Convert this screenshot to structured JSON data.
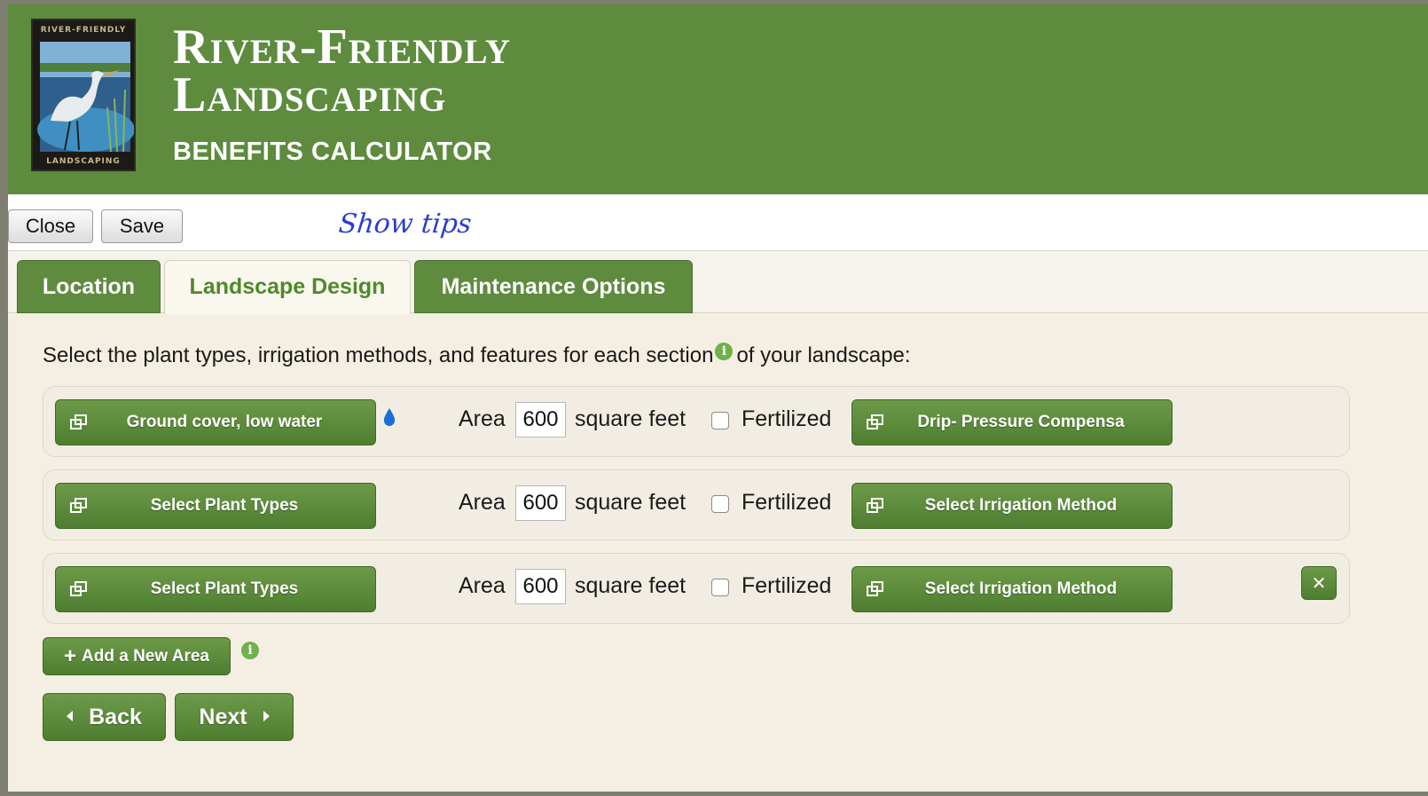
{
  "header": {
    "logo_top_text": "RIVER-FRIENDLY",
    "logo_bottom_text": "LANDSCAPING",
    "title_line1": "River-Friendly",
    "title_line2": "Landscaping",
    "subtitle": "BENEFITS CALCULATOR"
  },
  "toolbar": {
    "close_label": "Close",
    "save_label": "Save",
    "tips_label": "Show tips"
  },
  "tabs": [
    {
      "label": "Location",
      "active": false
    },
    {
      "label": "Landscape Design",
      "active": true
    },
    {
      "label": "Maintenance Options",
      "active": false
    }
  ],
  "instructions": {
    "before": "Select the plant types, irrigation methods, and features for each section",
    "after": "of your landscape:"
  },
  "areas": [
    {
      "plant": "Ground cover, low water",
      "area_label": "Area",
      "area_value": "600",
      "unit": "square feet",
      "fertilized_label": "Fertilized",
      "fertilized": false,
      "irrigation": "Drip- Pressure Compensa"
    },
    {
      "plant": "Select Plant Types",
      "area_label": "Area",
      "area_value": "600",
      "unit": "square feet",
      "fertilized_label": "Fertilized",
      "fertilized": false,
      "irrigation": "Select Irrigation Method"
    },
    {
      "plant": "Select Plant Types",
      "area_label": "Area",
      "area_value": "600",
      "unit": "square feet",
      "fertilized_label": "Fertilized",
      "fertilized": false,
      "irrigation": "Select Irrigation Method"
    }
  ],
  "actions": {
    "add_area_label": "Add a New Area",
    "back_label": "Back",
    "next_label": "Next"
  },
  "colors": {
    "brand_green": "#5e8b3e",
    "button_green": "#5f8d3d",
    "active_tab_text": "#4f8a2a",
    "tips_blue": "#2a3fc9",
    "background": "#f4efe2"
  }
}
